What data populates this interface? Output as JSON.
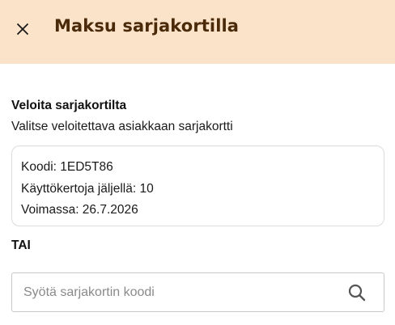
{
  "header": {
    "close_icon": "close-icon",
    "title": "Maksu sarjakortilla",
    "background": "#fbe3c9",
    "title_color": "#4a2a08"
  },
  "charge_section": {
    "title": "Veloita sarjakortilta",
    "subtitle": "Valitse veloitettava asiakkaan sarjakortti"
  },
  "card": {
    "code": "Koodi: 1ED5T86",
    "uses_left": "Käyttökertoja jäljellä: 10",
    "valid_until": "Voimassa: 26.7.2026"
  },
  "or_label": "TAI",
  "code_search": {
    "value": "",
    "placeholder": "Syötä sarjakortin koodi",
    "icon": "search-icon"
  }
}
